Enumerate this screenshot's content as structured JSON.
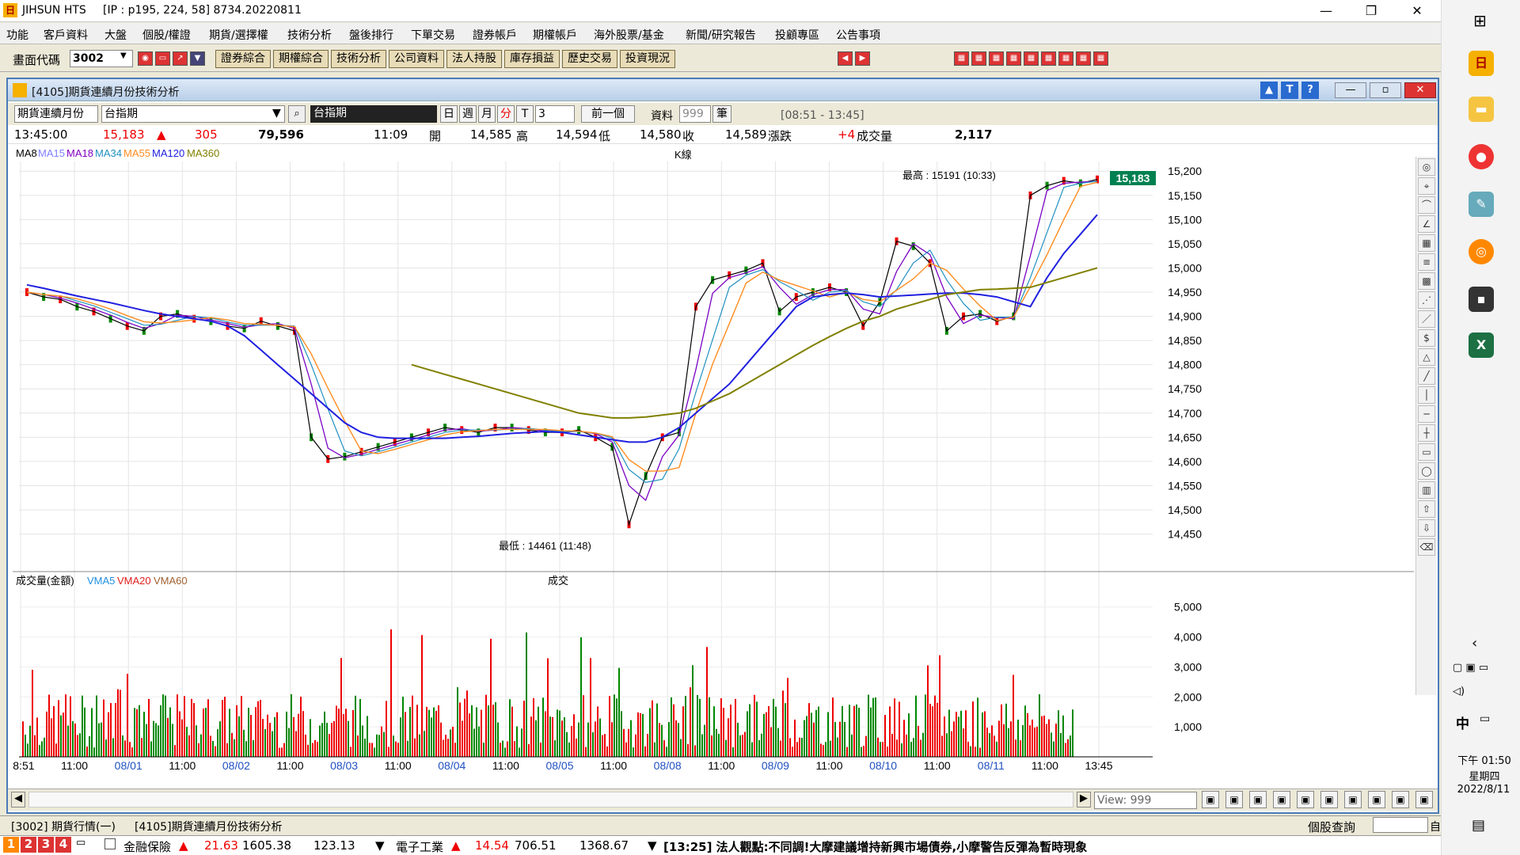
{
  "window": {
    "app_name": "JIHSUN HTS",
    "info": "[IP : p195, 224, 58] 8734.20220811"
  },
  "menu": [
    "功能",
    "客戶資料",
    "大盤",
    "個股/權證",
    "期貨/選擇權",
    "技術分析",
    "盤後排行",
    "下單交易",
    "證券帳戶",
    "期權帳戶",
    "海外股票/基金",
    "新聞/研究報告",
    "投顧專區",
    "公告事項"
  ],
  "toolbar": {
    "code_label": "畫面代碼",
    "code_value": "3002",
    "buttons": [
      "證券綜合",
      "期權綜合",
      "技術分析",
      "公司資料",
      "法人持股",
      "庫存損益",
      "歷史交易",
      "投資現況"
    ]
  },
  "child": {
    "title": "[4105]期貨連續月份技術分析",
    "selector1": "期貨連續月份",
    "selector2": "台指期",
    "product": "台指期",
    "periods": [
      "日",
      "週",
      "月",
      "分",
      "T"
    ],
    "period_value": "3",
    "prev_button": "前一個",
    "data_label": "資料",
    "data_value": "999",
    "unit": "筆",
    "time_range": "[08:51 - 13:45]"
  },
  "quote": {
    "time": "13:45:00",
    "price": "15,183",
    "change": "305",
    "volume_total": "79,596",
    "last_time": "11:09",
    "open_label": "開",
    "open": "14,585",
    "high_label": "高",
    "high": "14,594",
    "low_label": "低",
    "low": "14,580",
    "close_label": "收",
    "close": "14,589",
    "chg_label": "漲跌",
    "chg": "+4",
    "vol_label": "成交量",
    "vol": "2,117"
  },
  "chart_data": {
    "type": "line",
    "title": "K線",
    "ma_legend": [
      {
        "name": "MA8",
        "color": "#000000"
      },
      {
        "name": "MA15",
        "color": "#8080ff"
      },
      {
        "name": "MA18",
        "color": "#8000c0"
      },
      {
        "name": "MA34",
        "color": "#2090c0"
      },
      {
        "name": "MA55",
        "color": "#ff8c20"
      },
      {
        "name": "MA120",
        "color": "#2020e0"
      },
      {
        "name": "MA360",
        "color": "#808000"
      }
    ],
    "y_ticks": [
      15200,
      15150,
      15100,
      15050,
      15000,
      14950,
      14900,
      14850,
      14800,
      14750,
      14700,
      14650,
      14600,
      14550,
      14500,
      14450
    ],
    "y_tick_labels": [
      "15,200",
      "15,150",
      "15,100",
      "15,050",
      "15,000",
      "14,950",
      "14,900",
      "14,850",
      "14,800",
      "14,750",
      "14,700",
      "14,650",
      "14,600",
      "14,550",
      "14,500",
      "14,450"
    ],
    "ylim": [
      14410,
      15220
    ],
    "x_labels": [
      "08:51",
      "11:00",
      "08/01",
      "11:00",
      "08/02",
      "11:00",
      "08/03",
      "11:00",
      "08/04",
      "11:00",
      "08/05",
      "11:00",
      "08/08",
      "11:00",
      "08/09",
      "11:00",
      "08/10",
      "11:00",
      "08/11",
      "11:00",
      "13:45"
    ],
    "last_price_label": "15,183",
    "high_annotation": "最高 : 15191 (10:33)",
    "low_annotation": "最低 : 14461 (11:48)",
    "price_series": [
      14950,
      14940,
      14935,
      14920,
      14910,
      14895,
      14880,
      14870,
      14900,
      14905,
      14895,
      14890,
      14880,
      14875,
      14890,
      14880,
      14870,
      14650,
      14605,
      14610,
      14620,
      14630,
      14640,
      14650,
      14660,
      14670,
      14665,
      14660,
      14670,
      14670,
      14665,
      14660,
      14660,
      14665,
      14650,
      14630,
      14470,
      14570,
      14650,
      14660,
      14920,
      14975,
      14985,
      14995,
      15010,
      14910,
      14940,
      14950,
      14960,
      14950,
      14880,
      14930,
      15055,
      15045,
      15010,
      14870,
      14900,
      14905,
      14890,
      14900,
      15150,
      15170,
      15180,
      15175,
      15183
    ],
    "ma120": [
      14965,
      14958,
      14950,
      14942,
      14935,
      14928,
      14920,
      14912,
      14905,
      14900,
      14895,
      14890,
      14880,
      14860,
      14830,
      14800,
      14770,
      14740,
      14710,
      14680,
      14660,
      14650,
      14648,
      14648,
      14648,
      14648,
      14650,
      14652,
      14655,
      14658,
      14660,
      14662,
      14660,
      14655,
      14650,
      14645,
      14640,
      14640,
      14650,
      14670,
      14700,
      14730,
      14760,
      14800,
      14840,
      14880,
      14920,
      14940,
      14945,
      14948,
      14945,
      14940,
      14942,
      14944,
      14946,
      14948,
      14948,
      14945,
      14940,
      14930,
      14920,
      14980,
      15030,
      15070,
      15110
    ],
    "ma360": [
      null,
      null,
      null,
      null,
      null,
      null,
      null,
      null,
      null,
      null,
      null,
      null,
      null,
      null,
      null,
      null,
      null,
      null,
      null,
      null,
      null,
      null,
      null,
      14800,
      14790,
      14780,
      14770,
      14760,
      14750,
      14740,
      14730,
      14720,
      14710,
      14700,
      14695,
      14690,
      14690,
      14692,
      14696,
      14700,
      14710,
      14725,
      14740,
      14760,
      14780,
      14800,
      14820,
      14840,
      14858,
      14875,
      14890,
      14900,
      14915,
      14925,
      14935,
      14945,
      14950,
      14955,
      14956,
      14958,
      14960,
      14970,
      14980,
      14990,
      15000
    ],
    "volume_chart": {
      "title": "成交",
      "legend": [
        {
          "name": "成交量(金額)",
          "color": "#000000"
        },
        {
          "name": "VMA5",
          "color": "#2090e0"
        },
        {
          "name": "VMA20",
          "color": "#e02020"
        },
        {
          "name": "VMA60",
          "color": "#a06030"
        }
      ],
      "y_ticks": [
        1000,
        2000,
        3000,
        4000,
        5000
      ],
      "y_tick_labels": [
        "1,000",
        "2,000",
        "3,000",
        "4,000",
        "5,000"
      ],
      "ylim": [
        0,
        5600
      ]
    }
  },
  "rightbar_icons": [
    "target-icon",
    "cursor-icon",
    "arc-icon",
    "fan-icon",
    "grid-icon",
    "lines-icon",
    "pattern-icon",
    "fan2-icon",
    "line-icon",
    "s-icon",
    "triangle-icon",
    "ray-icon",
    "vline-icon",
    "hline-icon",
    "cross-icon",
    "rect-icon",
    "ellipse-icon",
    "bars-icon",
    "up-arrow-icon",
    "down-arrow-icon",
    "eraser-icon"
  ],
  "bottom_tabs": [
    "[3002] 期貨行情(一)",
    "[4105]期貨連續月份技術分析"
  ],
  "view_label": "View: 999",
  "stock_query": "個股查詢",
  "self_label": "自",
  "ticker": {
    "pages": [
      "1",
      "2",
      "3",
      "4"
    ],
    "a_name": "金融保險",
    "a_change": "21.63",
    "a_index": "1605.38",
    "a_vol": "123.13",
    "b_name": "電子工業",
    "b_change": "14.54",
    "b_index": "706.51",
    "b_vol": "1368.67",
    "news": "[13:25] 法人觀點:不同調!大摩建議增持新興市場債券,小摩警告反彈為暫時現象"
  },
  "tray": {
    "ime": "中",
    "time": "下午 01:50",
    "weekday": "星期四",
    "date": "2022/8/11"
  }
}
